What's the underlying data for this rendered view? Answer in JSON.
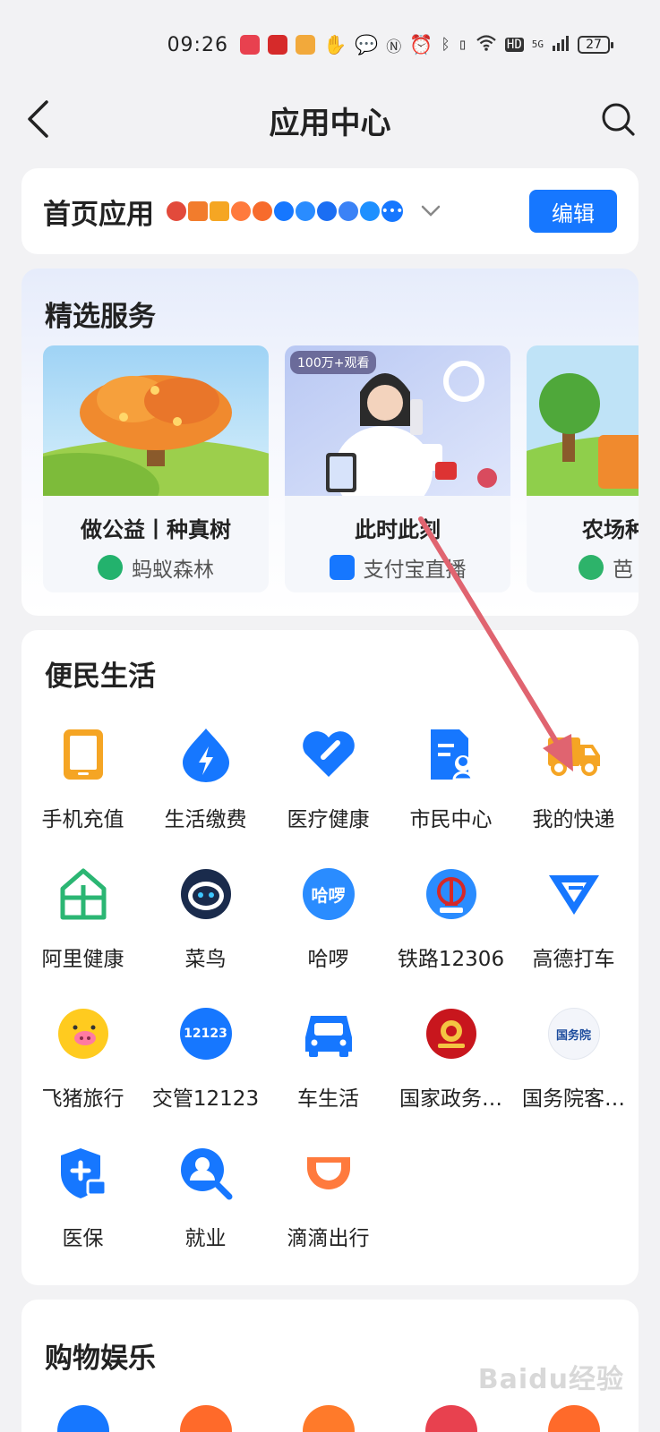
{
  "status_bar": {
    "time": "09:26",
    "battery": "27",
    "network": "5G",
    "hd": "HD"
  },
  "nav": {
    "title": "应用中心"
  },
  "home_apps": {
    "title": "首页应用",
    "edit_label": "编辑"
  },
  "featured": {
    "title": "精选服务",
    "items": [
      {
        "name": "做公益丨种真树",
        "source": "蚂蚁森林"
      },
      {
        "name": "此时此刻",
        "source": "支付宝直播",
        "badge": "100万+观看"
      },
      {
        "name": "农场种",
        "source": "芭"
      }
    ]
  },
  "life": {
    "title": "便民生活",
    "items": [
      {
        "label": "手机充值",
        "icon": "phone-icon"
      },
      {
        "label": "生活缴费",
        "icon": "lightning-drop-icon"
      },
      {
        "label": "医疗健康",
        "icon": "heart-icon"
      },
      {
        "label": "市民中心",
        "icon": "citizen-card-icon"
      },
      {
        "label": "我的快递",
        "icon": "delivery-truck-icon"
      },
      {
        "label": "阿里健康",
        "icon": "house-heart-icon"
      },
      {
        "label": "菜鸟",
        "icon": "cainiao-icon"
      },
      {
        "label": "哈啰",
        "icon": "hello-icon",
        "text": "哈啰"
      },
      {
        "label": "铁路12306",
        "icon": "railway-icon"
      },
      {
        "label": "高德打车",
        "icon": "amap-taxi-icon"
      },
      {
        "label": "飞猪旅行",
        "icon": "fliggy-icon"
      },
      {
        "label": "交管12123",
        "icon": "traffic-12123-icon",
        "text": "12123"
      },
      {
        "label": "车生活",
        "icon": "car-icon"
      },
      {
        "label": "国家政务…",
        "icon": "national-emblem-icon"
      },
      {
        "label": "国务院客…",
        "icon": "state-council-icon",
        "text": "国务院"
      },
      {
        "label": "医保",
        "icon": "medical-insurance-icon"
      },
      {
        "label": "就业",
        "icon": "job-search-icon"
      },
      {
        "label": "滴滴出行",
        "icon": "didi-icon"
      }
    ]
  },
  "shop": {
    "title": "购物娱乐"
  },
  "watermark": "Baidu经验",
  "colors": {
    "accent": "#1677ff",
    "annotation": "#e06470"
  }
}
